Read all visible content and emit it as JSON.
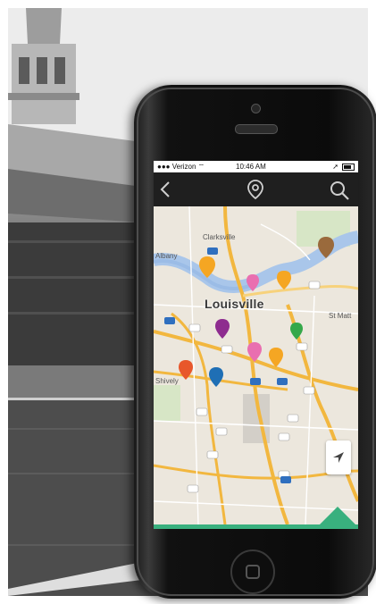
{
  "status_bar": {
    "carrier": "Verizon",
    "time": "10:46 AM"
  },
  "nav_bar": {
    "back_icon": "chevron-left-icon",
    "center_icon": "map-pin-icon",
    "right_icon": "search-icon"
  },
  "map": {
    "city_label": "Louisville",
    "place_labels": [
      "Clarksville",
      "Albany",
      "St Matt",
      "Shively"
    ],
    "pin_colors": {
      "orange": "#f5a623",
      "pink": "#e96fb0",
      "purple": "#8e2c8f",
      "green": "#35a84a",
      "red_orange": "#e8572b",
      "blue": "#1f6fb5",
      "brown": "#9a6a3c"
    }
  },
  "colors": {
    "accent_green": "#39b07e",
    "nav_dark": "#1f1f1f"
  }
}
